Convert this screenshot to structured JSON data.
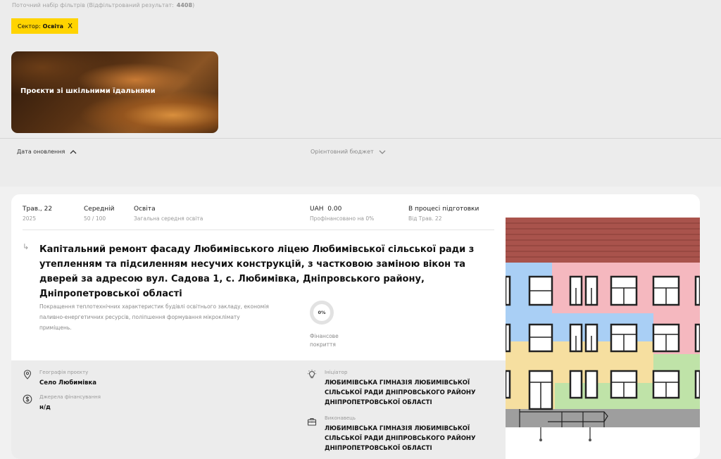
{
  "filters": {
    "summary_label": "Поточний набір фільтрів (Відфільтрований результат:",
    "count": "4408",
    "summary_close": ")",
    "chip_label": "Сектор:",
    "chip_value": "Освіта",
    "chip_remove": "X"
  },
  "collection": {
    "title": "Проєкти зі шкільними їдальнями"
  },
  "sort": {
    "date_label": "Дата оновлення",
    "budget_label": "Орієнтовний бюджет"
  },
  "project": {
    "date": "Трав., 22",
    "year": "2025",
    "level": "Середній",
    "score": "50 / 100",
    "sector": "Освіта",
    "subsector": "Загальна середня освіта",
    "currency": "UAH",
    "amount": "0.00",
    "financed": "Профінансовано на 0%",
    "status": "В процесі підготовки",
    "status_since": "Від Трав. 22",
    "arrow": "↳",
    "title": "Капітальний ремонт фасаду Любимівського ліцею Любимівської сільської ради з утепленням та підсиленням несучих конструкцій, з частковою заміною вікон та дверей за адресою вул. Садова 1, с. Любимівка, Дніпровського району, Дніпропетровської області",
    "description": "Покращення теплотехнічних характеристик будівлі освітнього закладу, економія паливно-енергетичних ресурсів, поліпшення формування мікроклімату приміщень.",
    "coverage_percent": "0%",
    "coverage_value": 0,
    "coverage_label": "Фінансове покриття",
    "geo_label": "Географія проєкту",
    "geo_value": "Село Любимівка",
    "funding_label": "Джерела фінансування",
    "funding_value": "н/д",
    "initiator_label": "Ініціатор",
    "initiator_value": "ЛЮБИМІВСЬКА ГІМНАЗІЯ ЛЮБИМІВСЬКОЇ СІЛЬСЬКОЇ РАДИ ДНІПРОВСЬКОГО РАЙОНУ ДНІПРОПЕТРОВСЬКОЇ ОБЛАСТІ",
    "executor_label": "Виконавець",
    "executor_value": "ЛЮБИМІВСЬКА ГІМНАЗІЯ ЛЮБИМІВСЬКОЇ СІЛЬСЬКОЇ РАДИ ДНІПРОВСЬКОГО РАЙОНУ ДНІПРОПЕТРОВСЬКОЇ ОБЛАСТІ"
  },
  "colors": {
    "chip": "#ffd400",
    "building_blue": "#a9cff5",
    "building_pink": "#f5b8bf",
    "building_yellow": "#f6dfa0",
    "building_green": "#bfe3a8",
    "roof": "#a9534c"
  },
  "icons": [
    "location-pin-icon",
    "money-bag-icon",
    "lightbulb-icon",
    "briefcase-icon",
    "chevron-up-icon",
    "chevron-down-icon",
    "close-icon"
  ]
}
